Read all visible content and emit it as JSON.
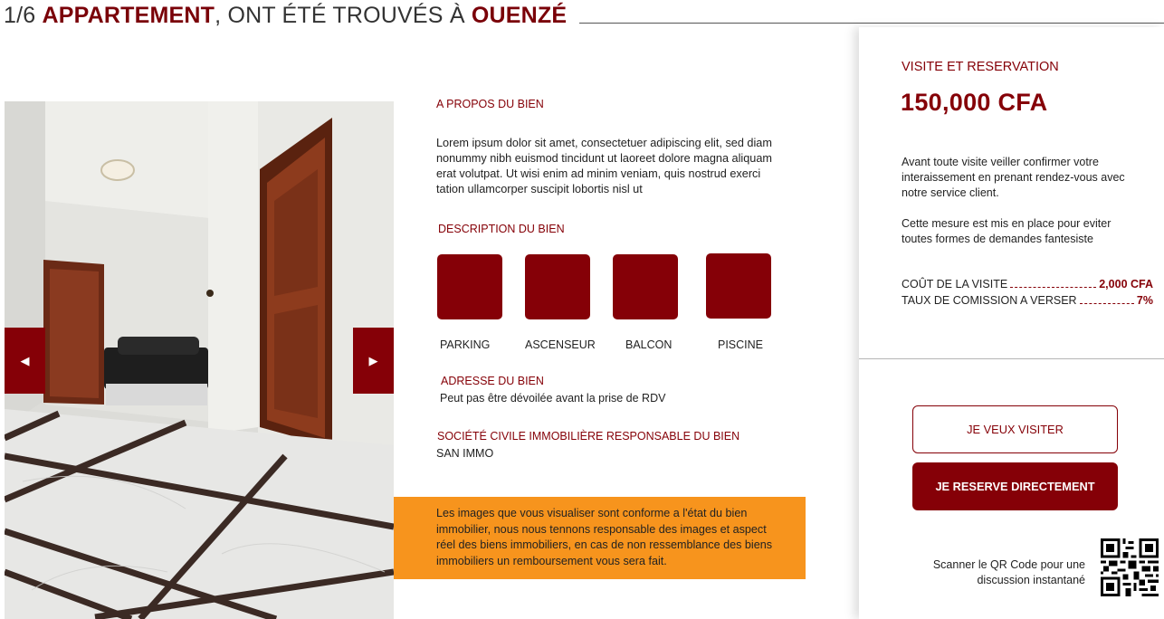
{
  "header": {
    "count": "1/6",
    "type": "APPARTEMENT",
    "middle": ", ONT ÉTÉ TROUVÉS À",
    "location": "OUENZÉ"
  },
  "gallery": {
    "prev_icon": "◀",
    "next_icon": "▶"
  },
  "about": {
    "title": "A PROPOS DU BIEN",
    "text": "Lorem ipsum dolor sit amet, consectetuer adipiscing elit, sed diam nonummy nibh euismod tincidunt ut laoreet dolore magna aliquam erat volutpat. Ut wisi enim ad minim veniam, quis nostrud exerci tation ullamcorper suscipit lobortis nisl ut"
  },
  "description": {
    "title": "DESCRIPTION DU BIEN",
    "features": [
      {
        "label": "PARKING",
        "icon": "parking-icon"
      },
      {
        "label": "ASCENSEUR",
        "icon": "elevator-icon"
      },
      {
        "label": "BALCON",
        "icon": "balcony-icon"
      },
      {
        "label": "PISCINE",
        "icon": "pool-icon"
      }
    ]
  },
  "address": {
    "title": "ADRESSE DU BIEN",
    "text": "Peut pas être dévoilée avant la prise de RDV"
  },
  "agency": {
    "title": "SOCIÉTÉ CIVILE IMMOBILIÈRE RESPONSABLE DU BIEN",
    "name": "SAN IMMO"
  },
  "notice": {
    "text": "Les images que vous visualiser sont conforme a l'état du bien immobilier, nous nous tennons responsable des images et aspect réel des biens immobiliers, en cas de non ressemblance des biens immobiliers un remboursement vous sera fait."
  },
  "panel": {
    "title": "VISITE ET RESERVATION",
    "price": "150,000 CFA",
    "text1": "Avant toute visite veiller confirmer votre interaissement en prenant rendez-vous avec notre service client.",
    "text2": "Cette mesure est mis en place pour eviter toutes formes de demandes fantesiste",
    "visit_cost_label": "COÛT DE LA VISITE",
    "visit_cost_value": "2,000 CFA",
    "commission_label": "TAUX DE COMISSION A VERSER",
    "commission_value": "7%",
    "visit_button": "JE VEUX VISITER",
    "reserve_button": "JE RESERVE DIRECTEMENT",
    "qr_text": "Scanner le QR Code pour une discussion instantané"
  },
  "colors": {
    "brand": "#850007",
    "notice_bg": "#f7941d"
  }
}
